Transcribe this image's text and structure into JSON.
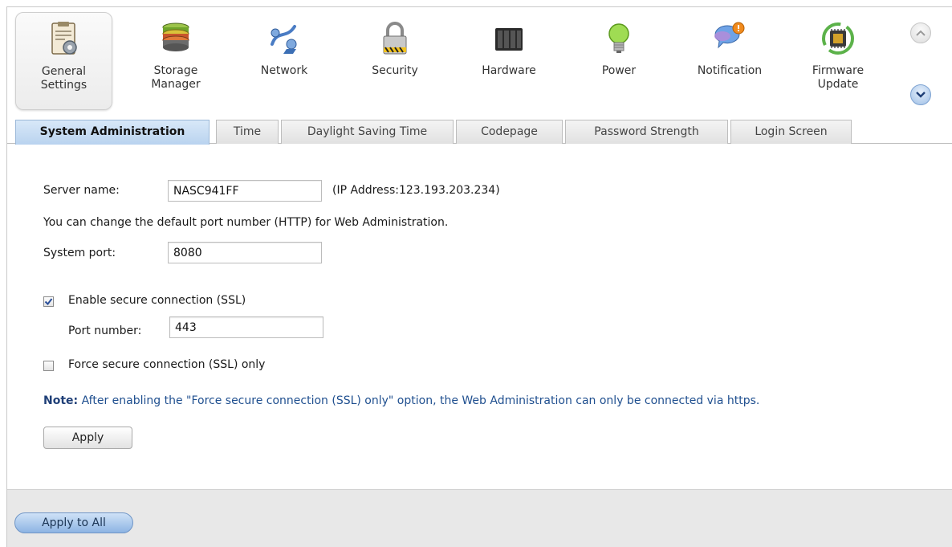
{
  "toolbar": {
    "items": [
      {
        "label": "General\nSettings",
        "icon": "general-settings-icon",
        "active": true
      },
      {
        "label": "Storage\nManager",
        "icon": "storage-icon"
      },
      {
        "label": "Network",
        "icon": "network-icon"
      },
      {
        "label": "Security",
        "icon": "lock-icon"
      },
      {
        "label": "Hardware",
        "icon": "hardware-icon"
      },
      {
        "label": "Power",
        "icon": "lightbulb-icon"
      },
      {
        "label": "Notification",
        "icon": "notification-icon"
      },
      {
        "label": "Firmware\nUpdate",
        "icon": "chip-icon"
      }
    ],
    "scroll_up_icon": "chevron-up-icon",
    "scroll_down_icon": "chevron-down-icon"
  },
  "tabs": [
    {
      "label": "System Administration",
      "active": true
    },
    {
      "label": "Time"
    },
    {
      "label": "Daylight Saving Time"
    },
    {
      "label": "Codepage"
    },
    {
      "label": "Password Strength"
    },
    {
      "label": "Login Screen"
    }
  ],
  "form": {
    "server_name_label": "Server name:",
    "server_name_value": "NASC941FF",
    "ip_address": "(IP Address:123.193.203.234)",
    "port_hint": "You can change the default port number (HTTP) for Web Administration.",
    "system_port_label": "System port:",
    "system_port_value": "8080",
    "ssl_label": "Enable secure connection (SSL)",
    "ssl_checked": true,
    "ssl_port_label": "Port number:",
    "ssl_port_value": "443",
    "force_ssl_label": "Force secure connection (SSL) only",
    "force_ssl_checked": false,
    "note_prefix": "Note:",
    "note_text": " After enabling the \"Force secure connection (SSL) only\" option, the Web Administration can only be connected via https.",
    "apply_label": "Apply"
  },
  "footer": {
    "apply_all_label": "Apply to All"
  },
  "colors": {
    "accent": "#8db4e3",
    "note_text": "#1f4f8f",
    "active_tab": "#b9d3ef"
  }
}
